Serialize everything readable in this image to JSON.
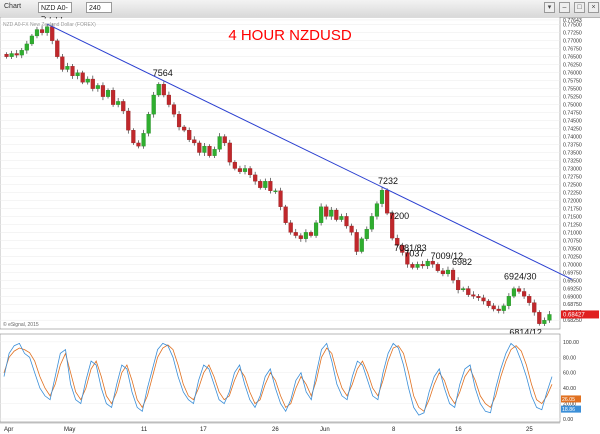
{
  "toolbar": {
    "window_label": "Chart",
    "symbol": "NZD A0-F",
    "interval": "240",
    "faint_caption": "NZD A0-FX  New Zealand Dollar (FOREX)"
  },
  "chart_data": [
    {
      "type": "candlestick",
      "title": "4 HOUR NZDUSD",
      "y_ticks": [
        0.7765,
        0.775,
        0.7725,
        0.77,
        0.7675,
        0.765,
        0.7625,
        0.76,
        0.7575,
        0.755,
        0.7525,
        0.75,
        0.7475,
        0.745,
        0.7425,
        0.74,
        0.7375,
        0.735,
        0.7325,
        0.73,
        0.7275,
        0.725,
        0.7225,
        0.72,
        0.7175,
        0.715,
        0.7125,
        0.71,
        0.7075,
        0.705,
        0.7025,
        0.7,
        0.6975,
        0.695,
        0.6925,
        0.69,
        0.6875,
        0.685,
        0.6825
      ],
      "y_tick_labels": [
        "0.77643",
        "0.77500",
        "0.77250",
        "0.77000",
        "0.76750",
        "0.76500",
        "0.76250",
        "0.76000",
        "0.75750",
        "0.75500",
        "0.75250",
        "0.75000",
        "0.74750",
        "0.74500",
        "0.74250",
        "0.74000",
        "0.73750",
        "0.73500",
        "0.73250",
        "0.73000",
        "0.72750",
        "0.72500",
        "0.72250",
        "0.72000",
        "0.71750",
        "0.71500",
        "0.71250",
        "0.71000",
        "0.70750",
        "0.70500",
        "0.70250",
        "0.70000",
        "0.69750",
        "0.69500",
        "0.69250",
        "0.69000",
        "0.68750",
        "0.68500",
        "0.68250"
      ],
      "ylim": [
        0.681,
        0.7768
      ],
      "x_labels": [
        "Apr",
        "May",
        "11",
        "17",
        "26",
        "Jun",
        "8",
        "16",
        "25"
      ],
      "last_price_label": "0.68427",
      "last_price": 0.6843,
      "trendline": {
        "from_label": "7744",
        "to_label": ""
      },
      "annotations": [
        "7744",
        "7564",
        "7232",
        "7200",
        "7081/83",
        "7037",
        "7009/12",
        "6982",
        "6924/30",
        "6814/12"
      ],
      "closes": [
        0.765,
        0.766,
        0.7655,
        0.767,
        0.769,
        0.7715,
        0.7735,
        0.7725,
        0.7744,
        0.77,
        0.765,
        0.761,
        0.762,
        0.759,
        0.76,
        0.757,
        0.758,
        0.755,
        0.756,
        0.7525,
        0.7545,
        0.75,
        0.751,
        0.748,
        0.742,
        0.738,
        0.737,
        0.741,
        0.747,
        0.753,
        0.7564,
        0.753,
        0.75,
        0.747,
        0.743,
        0.742,
        0.739,
        0.738,
        0.735,
        0.737,
        0.734,
        0.736,
        0.74,
        0.738,
        0.732,
        0.73,
        0.729,
        0.73,
        0.728,
        0.726,
        0.724,
        0.726,
        0.723,
        0.723,
        0.718,
        0.713,
        0.71,
        0.709,
        0.708,
        0.71,
        0.709,
        0.713,
        0.718,
        0.715,
        0.717,
        0.714,
        0.715,
        0.712,
        0.71,
        0.704,
        0.708,
        0.711,
        0.715,
        0.719,
        0.7232,
        0.716,
        0.7082,
        0.706,
        0.7037,
        0.7,
        0.699,
        0.7,
        0.6995,
        0.701,
        0.7,
        0.698,
        0.697,
        0.6982,
        0.695,
        0.692,
        0.6924,
        0.6905,
        0.69,
        0.6895,
        0.6885,
        0.687,
        0.686,
        0.6855,
        0.687,
        0.69,
        0.6924,
        0.6915,
        0.69,
        0.688,
        0.685,
        0.6814,
        0.6825,
        0.6843
      ],
      "last_label": "© eSignal, 2015"
    },
    {
      "type": "line",
      "title": "Stochastic oscillator",
      "y_ticks": [
        100,
        80,
        60,
        40,
        20,
        0
      ],
      "y_tick_labels": [
        "100.00",
        "80.00",
        "60.00",
        "40.00",
        "20.00",
        "0.00"
      ],
      "ylim": [
        0,
        105
      ],
      "value_labels": [
        "26.05",
        "18.86"
      ],
      "series": [
        {
          "color": "#e07020",
          "values": [
            60,
            80,
            88,
            92,
            90,
            86,
            75,
            55,
            40,
            30,
            45,
            70,
            85,
            60,
            35,
            25,
            40,
            65,
            75,
            55,
            30,
            20,
            35,
            60,
            70,
            50,
            25,
            15,
            30,
            55,
            80,
            92,
            96,
            90,
            70,
            45,
            30,
            25,
            40,
            60,
            70,
            55,
            35,
            25,
            30,
            50,
            65,
            55,
            35,
            20,
            25,
            45,
            60,
            50,
            30,
            15,
            20,
            40,
            55,
            45,
            30,
            50,
            80,
            92,
            85,
            60,
            40,
            30,
            45,
            65,
            75,
            60,
            40,
            30,
            50,
            75,
            92,
            95,
            85,
            60,
            30,
            15,
            10,
            25,
            45,
            60,
            50,
            30,
            20,
            35,
            55,
            65,
            50,
            30,
            20,
            15,
            30,
            55,
            75,
            90,
            95,
            88,
            70,
            45,
            25,
            20,
            30,
            45
          ]
        },
        {
          "color": "#3b8fd8",
          "values": [
            55,
            85,
            95,
            98,
            85,
            80,
            60,
            40,
            30,
            25,
            55,
            85,
            90,
            45,
            25,
            20,
            50,
            75,
            70,
            40,
            20,
            15,
            45,
            70,
            65,
            35,
            15,
            10,
            40,
            65,
            90,
            98,
            95,
            80,
            55,
            35,
            25,
            20,
            50,
            70,
            65,
            45,
            25,
            20,
            35,
            60,
            70,
            45,
            25,
            15,
            30,
            55,
            65,
            40,
            20,
            10,
            25,
            50,
            60,
            35,
            25,
            60,
            90,
            98,
            75,
            45,
            30,
            25,
            55,
            75,
            70,
            50,
            30,
            25,
            60,
            85,
            98,
            92,
            70,
            40,
            15,
            5,
            8,
            35,
            55,
            65,
            40,
            20,
            15,
            45,
            65,
            70,
            40,
            20,
            10,
            8,
            40,
            65,
            85,
            98,
            92,
            75,
            55,
            30,
            15,
            12,
            35,
            55
          ]
        }
      ]
    }
  ]
}
